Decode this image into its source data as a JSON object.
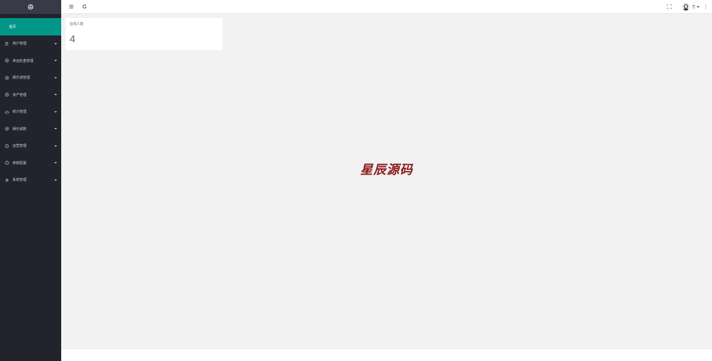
{
  "sidebar": {
    "items": [
      {
        "label": "首页",
        "icon": "home-icon",
        "active": true
      },
      {
        "label": "用户管理",
        "icon": "user-icon"
      },
      {
        "label": "幸运轮盘管理",
        "icon": "circle-dot-icon"
      },
      {
        "label": "娱乐城管理",
        "icon": "circle-dot-icon"
      },
      {
        "label": "资产管理",
        "icon": "circle-dot-icon"
      },
      {
        "label": "统计管理",
        "icon": "cloud-icon"
      },
      {
        "label": "娱乐城数",
        "icon": "circle-dot-icon"
      },
      {
        "label": "运营管理",
        "icon": "clock-icon"
      },
      {
        "label": "参数配置",
        "icon": "info-icon"
      },
      {
        "label": "系统管理",
        "icon": "gear-icon"
      }
    ]
  },
  "header": {
    "user_name": "王"
  },
  "stat_card": {
    "title": "在线人数",
    "value": "4"
  },
  "watermark": "星辰源码",
  "colors": {
    "sidebar_bg": "#22232d",
    "active_bg": "#009688",
    "watermark": "#8b1a1a"
  }
}
